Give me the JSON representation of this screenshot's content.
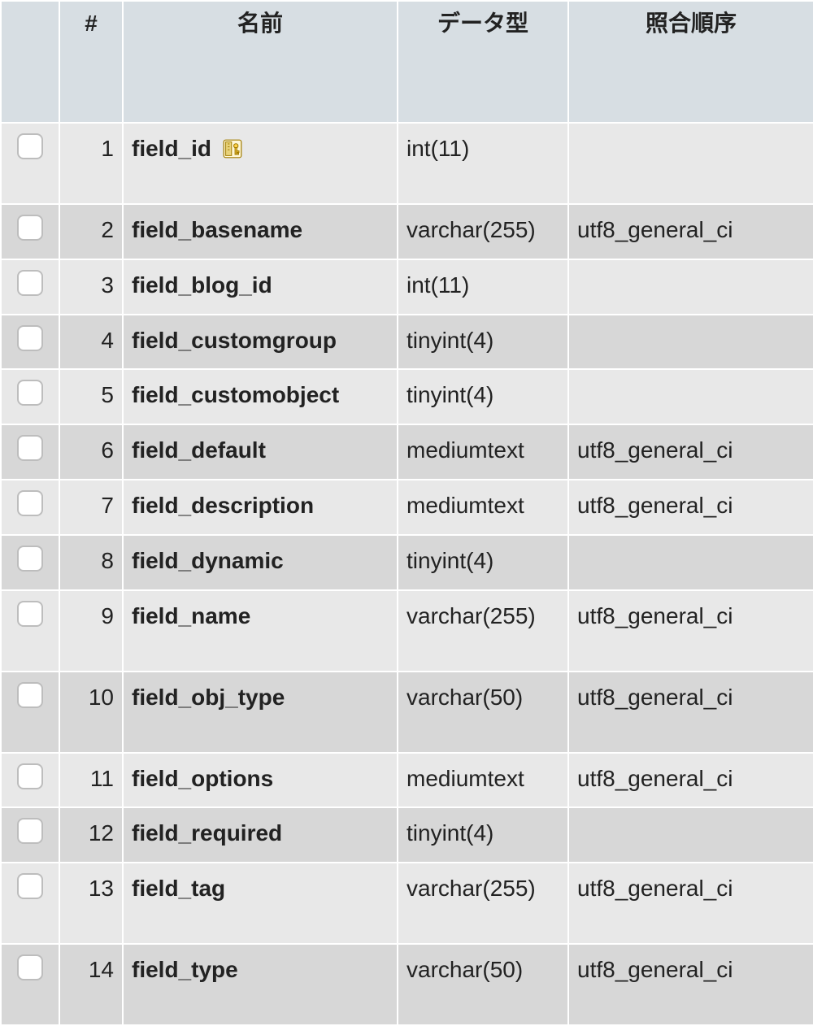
{
  "headers": {
    "checkbox": "",
    "num": "#",
    "name": "名前",
    "datatype": "データ型",
    "collation": "照合順序"
  },
  "rows": [
    {
      "num": "1",
      "name": "field_id",
      "pk": true,
      "datatype": "int(11)",
      "collation": "",
      "tall": true
    },
    {
      "num": "2",
      "name": "field_basename",
      "pk": false,
      "datatype": "varchar(255)",
      "collation": "utf8_general_ci",
      "tall": false
    },
    {
      "num": "3",
      "name": "field_blog_id",
      "pk": false,
      "datatype": "int(11)",
      "collation": "",
      "tall": false
    },
    {
      "num": "4",
      "name": "field_customgroup",
      "pk": false,
      "datatype": "tinyint(4)",
      "collation": "",
      "tall": false
    },
    {
      "num": "5",
      "name": "field_customobject",
      "pk": false,
      "datatype": "tinyint(4)",
      "collation": "",
      "tall": false
    },
    {
      "num": "6",
      "name": "field_default",
      "pk": false,
      "datatype": "mediumtext",
      "collation": "utf8_general_ci",
      "tall": false
    },
    {
      "num": "7",
      "name": "field_description",
      "pk": false,
      "datatype": "mediumtext",
      "collation": "utf8_general_ci",
      "tall": false
    },
    {
      "num": "8",
      "name": "field_dynamic",
      "pk": false,
      "datatype": "tinyint(4)",
      "collation": "",
      "tall": false
    },
    {
      "num": "9",
      "name": "field_name",
      "pk": false,
      "datatype": "varchar(255)",
      "collation": "utf8_general_ci",
      "tall": true
    },
    {
      "num": "10",
      "name": "field_obj_type",
      "pk": false,
      "datatype": "varchar(50)",
      "collation": "utf8_general_ci",
      "tall": true
    },
    {
      "num": "11",
      "name": "field_options",
      "pk": false,
      "datatype": "mediumtext",
      "collation": "utf8_general_ci",
      "tall": false
    },
    {
      "num": "12",
      "name": "field_required",
      "pk": false,
      "datatype": "tinyint(4)",
      "collation": "",
      "tall": false
    },
    {
      "num": "13",
      "name": "field_tag",
      "pk": false,
      "datatype": "varchar(255)",
      "collation": "utf8_general_ci",
      "tall": true
    },
    {
      "num": "14",
      "name": "field_type",
      "pk": false,
      "datatype": "varchar(50)",
      "collation": "utf8_general_ci",
      "tall": true
    }
  ]
}
